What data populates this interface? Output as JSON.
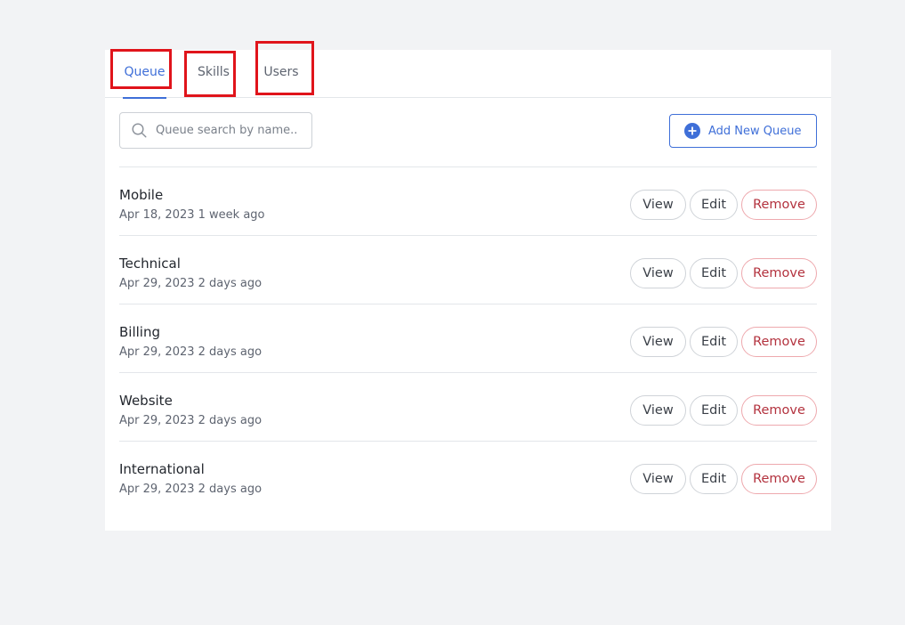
{
  "tabs": [
    {
      "label": "Queue",
      "active": true
    },
    {
      "label": "Skills",
      "active": false
    },
    {
      "label": "Users",
      "active": false
    }
  ],
  "search": {
    "placeholder": "Queue search by name..",
    "value": ""
  },
  "add_button": {
    "label": "Add New Queue"
  },
  "actions": {
    "view": "View",
    "edit": "Edit",
    "remove": "Remove"
  },
  "queues": [
    {
      "name": "Mobile",
      "meta": "Apr 18, 2023 1 week ago"
    },
    {
      "name": "Technical",
      "meta": "Apr 29, 2023 2 days ago"
    },
    {
      "name": "Billing",
      "meta": "Apr 29, 2023 2 days ago"
    },
    {
      "name": "Website",
      "meta": "Apr 29, 2023 2 days ago"
    },
    {
      "name": "International",
      "meta": "Apr 29, 2023 2 days ago"
    }
  ],
  "colors": {
    "accent": "#3f6fd8",
    "danger": "#b3323e",
    "annotation": "#e0141b",
    "background": "#f2f3f5"
  }
}
